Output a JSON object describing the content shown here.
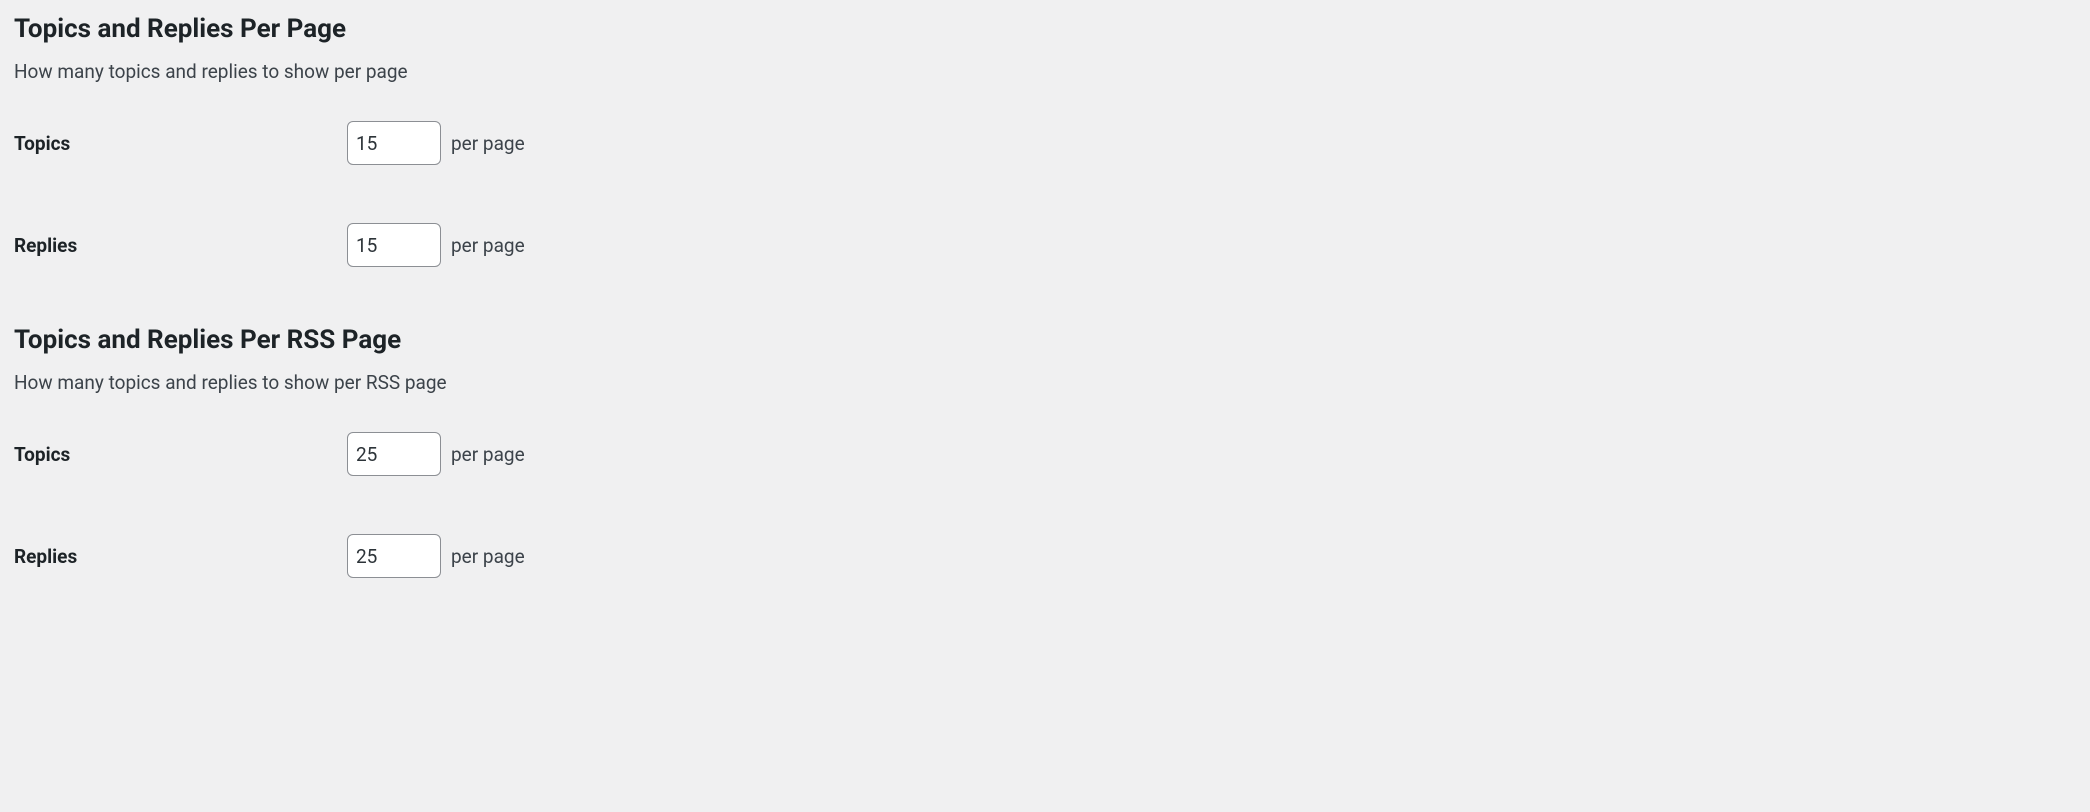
{
  "sections": [
    {
      "heading": "Topics and Replies Per Page",
      "description": "How many topics and replies to show per page",
      "fields": [
        {
          "label": "Topics",
          "value": "15",
          "suffix": "per page"
        },
        {
          "label": "Replies",
          "value": "15",
          "suffix": "per page"
        }
      ]
    },
    {
      "heading": "Topics and Replies Per RSS Page",
      "description": "How many topics and replies to show per RSS page",
      "fields": [
        {
          "label": "Topics",
          "value": "25",
          "suffix": "per page"
        },
        {
          "label": "Replies",
          "value": "25",
          "suffix": "per page"
        }
      ]
    }
  ]
}
